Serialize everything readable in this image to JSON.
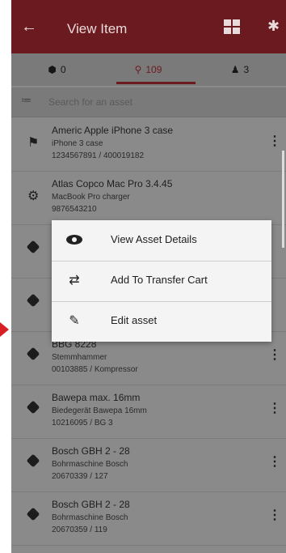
{
  "appbar": {
    "title": "View Item",
    "back_icon": "arrow-left-icon",
    "grid_icon": "grid-view-icon",
    "bt_icon": "bluetooth-icon",
    "color": "#6b1b1f"
  },
  "tabs": [
    {
      "icon": "cube-icon",
      "count": "0"
    },
    {
      "icon": "location-pin-icon",
      "count": "109"
    },
    {
      "icon": "people-icon",
      "count": "3"
    }
  ],
  "search": {
    "placeholder": "Search for an asset"
  },
  "items": [
    {
      "title": "Americ Apple iPhone 3 case",
      "subtitle": "iPhone 3 case",
      "code": "1234567891 / 400019182",
      "icon": "pin-icon"
    },
    {
      "title": "Atlas Copco Mac Pro 3.4.45",
      "subtitle": "MacBook Pro charger",
      "code": "9876543210",
      "icon": "gears-icon"
    },
    {
      "title": "",
      "subtitle": "",
      "code": "",
      "icon": "cube-icon"
    },
    {
      "title": "",
      "subtitle": "",
      "code": "",
      "icon": "cube-icon"
    },
    {
      "title": "BBG 8228",
      "subtitle": "Stemmhammer",
      "code": "00103885 / Kompressor",
      "icon": "cube-icon"
    },
    {
      "title": "Bawepa max. 16mm",
      "subtitle": "Biedegerät Bawepa 16mm",
      "code": "10216095 / BG 3",
      "icon": "cube-icon"
    },
    {
      "title": "Bosch GBH 2 - 28",
      "subtitle": "Bohrmaschine Bosch",
      "code": "20670339 / 127",
      "icon": "cube-icon"
    },
    {
      "title": "Bosch GBH 2 - 28",
      "subtitle": "Bohrmaschine Bosch",
      "code": "20670359 / 119",
      "icon": "cube-icon"
    }
  ],
  "menu": [
    {
      "label": "View Asset Details",
      "icon": "eye-icon"
    },
    {
      "label": "Add To Transfer Cart",
      "icon": "transfer-icon"
    },
    {
      "label": "Edit asset",
      "icon": "pencil-icon"
    }
  ]
}
